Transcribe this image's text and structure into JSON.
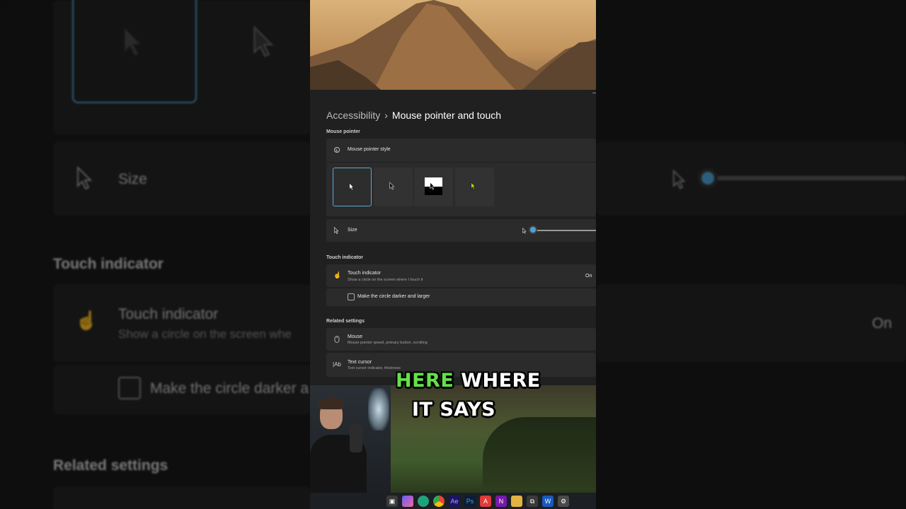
{
  "background": {
    "size_label": "Size",
    "touch_section": "Touch indicator",
    "touch_title": "Touch indicator",
    "touch_subtitle": "Show a circle on the screen whe",
    "touch_state": "On",
    "checkbox_label": "Make the circle darker a",
    "related_section": "Related settings"
  },
  "breadcrumb": {
    "parent": "Accessibility",
    "separator": "›",
    "current": "Mouse pointer and touch"
  },
  "mouse_pointer": {
    "section": "Mouse pointer",
    "style_label": "Mouse pointer style",
    "styles": [
      "White",
      "Black",
      "Inverted",
      "Custom"
    ],
    "selected_style": "White",
    "size_label": "Size",
    "size_level": 0.05
  },
  "touch_indicator": {
    "section": "Touch indicator",
    "title": "Touch indicator",
    "subtitle": "Show a circle on the screen where I touch it",
    "state": "On",
    "checkbox_label": "Make the circle darker and larger",
    "checkbox_checked": false
  },
  "related": {
    "section": "Related settings",
    "items": [
      {
        "title": "Mouse",
        "subtitle": "Mouse pointer speed, primary button, scrolling"
      },
      {
        "title": "Text cursor",
        "subtitle": "Text cursor indicator, thickness"
      }
    ]
  },
  "caption": {
    "line1_highlight": "HERE",
    "line1_rest": "WHERE",
    "line2": "IT SAYS"
  },
  "colors": {
    "accent": "#4aa3d8",
    "caption_highlight": "#63e14a",
    "custom_pointer": "#a6d81a"
  }
}
